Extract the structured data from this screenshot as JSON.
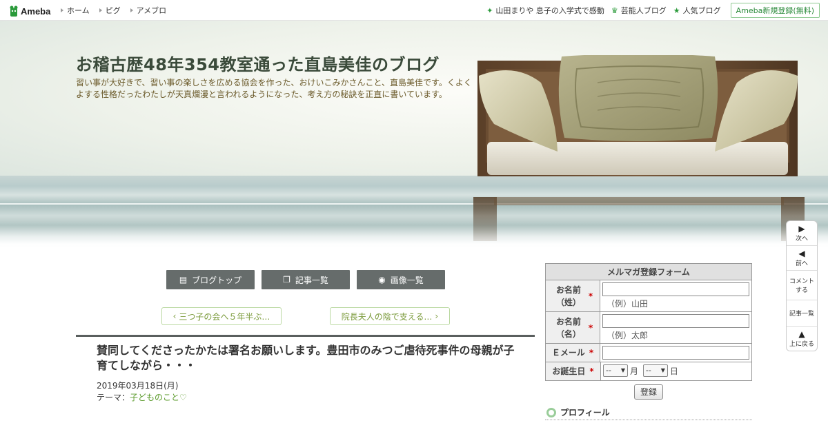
{
  "topbar": {
    "logo": "Ameba",
    "nav": [
      "ホーム",
      "ピグ",
      "アメブロ"
    ],
    "right_links": [
      {
        "icon": "sparkle-icon",
        "label": "山田まりや 息子の入学式で感動"
      },
      {
        "icon": "crown-icon",
        "label": "芸能人ブログ"
      },
      {
        "icon": "star-icon",
        "label": "人気ブログ"
      }
    ],
    "register": "Ameba新規登録(無料)"
  },
  "header": {
    "title": "お稽古歴48年354教室通った直島美佳のブログ",
    "description": "習い事が大好きで、習い事の楽しさを広める協会を作った、おけいこみかさんこと、直島美佳です。くよくよする性格だったわたしが天真爛漫と言われるようになった、考え方の秘訣を正直に書いています。"
  },
  "sidenav": {
    "next": "次へ",
    "prev": "前へ",
    "comment": "コメントする",
    "list": "記事一覧",
    "top": "上に戻る"
  },
  "buttons": {
    "blog_top": "ブログトップ",
    "articles": "記事一覧",
    "images": "画像一覧"
  },
  "pager": {
    "prev": "三つ子の会へ５年半ぶ…",
    "next": "院長夫人の陰で支える…"
  },
  "article": {
    "title": "賛同してくださったかたは署名お願いします。豊田市のみつご虐待死事件の母親が子育てしながら・・・",
    "date": "2019年03月18日(月)",
    "theme_label": "テーマ：",
    "theme": "子どものこと♡"
  },
  "form": {
    "heading": "メルマガ登録フォーム",
    "last_name_label": "お名前（姓）",
    "last_name_example": "（例）山田",
    "first_name_label": "お名前（名）",
    "first_name_example": "（例）太郎",
    "email_label": "Ｅメール",
    "birthday_label": "お誕生日",
    "month_value": "--",
    "month_unit": "月",
    "day_value": "--",
    "day_unit": "日",
    "required_mark": "*",
    "submit": "登録"
  },
  "sidebar": {
    "profile": "プロフィール"
  },
  "colors": {
    "accent_green": "#2a9a3a",
    "button_gray": "#666c6b",
    "pager_border": "#b9d8a0",
    "required": "#cc0000"
  }
}
